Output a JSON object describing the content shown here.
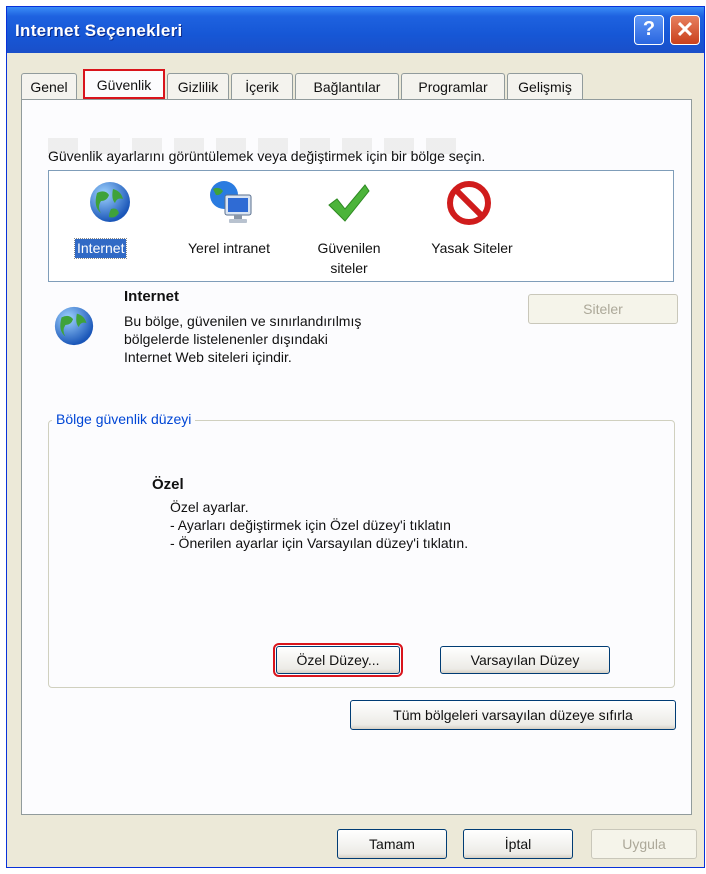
{
  "window": {
    "title": "Internet Seçenekleri",
    "help_label": "?",
    "close_label": "✕"
  },
  "tabs": [
    "Genel",
    "Güvenlik",
    "Gizlilik",
    "İçerik",
    "Bağlantılar",
    "Programlar",
    "Gelişmiş"
  ],
  "active_tab": "Güvenlik",
  "security": {
    "instruction": "Güvenlik ayarlarını görüntülemek veya değiştirmek için bir bölge seçin.",
    "zones": [
      {
        "line1": "Internet",
        "line2": "",
        "icon": "globe-icon"
      },
      {
        "line1": "Yerel intranet",
        "line2": "",
        "icon": "intranet-icon"
      },
      {
        "line1": "Güvenilen",
        "line2": "siteler",
        "icon": "checkmark-icon"
      },
      {
        "line1": "Yasak Siteler",
        "line2": "",
        "icon": "prohibited-icon"
      }
    ],
    "selected_zone": "Internet",
    "zone_info": {
      "title": "Internet",
      "desc_lines": [
        "Bu bölge, güvenilen ve sınırlandırılmış",
        "bölgelerde listelenenler dışındaki",
        "Internet Web siteleri içindir."
      ]
    },
    "sites_button": "Siteler",
    "level_group_title": "Bölge güvenlik düzeyi",
    "level": {
      "name": "Özel",
      "lines": [
        "Özel ayarlar.",
        "- Ayarları değiştirmek için Özel düzey'i tıklatın",
        "- Önerilen ayarlar için Varsayılan düzey'i tıklatın."
      ]
    },
    "custom_level_button": "Özel Düzey...",
    "default_level_button": "Varsayılan Düzey",
    "reset_all_button": "Tüm bölgeleri varsayılan düzeye sıfırla"
  },
  "footer": {
    "ok": "Tamam",
    "cancel": "İptal",
    "apply": "Uygula"
  }
}
